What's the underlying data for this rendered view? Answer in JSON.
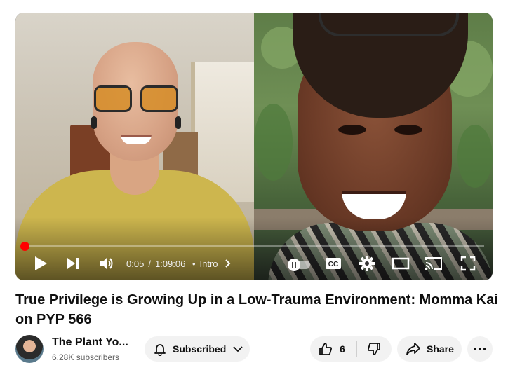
{
  "player": {
    "current_time": "0:05",
    "time_separator": "/",
    "duration": "1:09:06",
    "chapter_bullet": "•",
    "chapter": "Intro",
    "progress_fraction": 0.0012,
    "accent_color": "#ff0000"
  },
  "video": {
    "title": "True Privilege is Growing Up in a Low-Trauma Environment: Momma Kai on PYP 566"
  },
  "channel": {
    "name": "The Plant Yo...",
    "subscribers": "6.28K subscribers"
  },
  "actions": {
    "subscribe_label": "Subscribed",
    "like_count": "6",
    "share_label": "Share"
  },
  "icons": {
    "play": "play-icon",
    "next": "next-icon",
    "volume": "volume-icon",
    "autoplay": "autoplay-toggle",
    "captions": "captions-icon",
    "settings": "gear-icon",
    "miniplayer": "theater-icon",
    "cast": "cast-icon",
    "fullscreen": "fullscreen-icon",
    "bell": "bell-icon",
    "like": "thumbs-up-icon",
    "dislike": "thumbs-down-icon",
    "share": "share-icon",
    "more": "more-icon"
  }
}
